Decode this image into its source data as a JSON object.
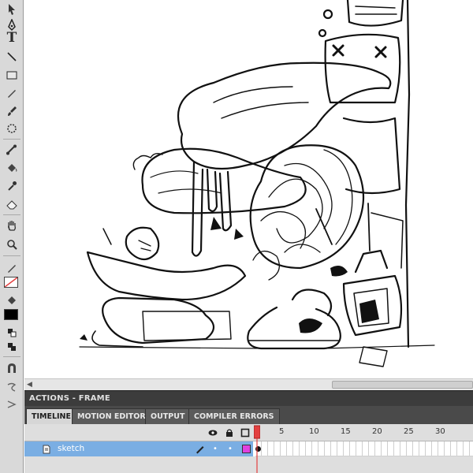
{
  "panels": {
    "actions_title": "ACTIONS - FRAME"
  },
  "timeline": {
    "tabs": [
      {
        "label": "TIMELINE",
        "active": true
      },
      {
        "label": "MOTION EDITOR",
        "active": false
      },
      {
        "label": "OUTPUT",
        "active": false
      },
      {
        "label": "COMPILER ERRORS",
        "active": false
      }
    ],
    "ruler": [
      "1",
      "5",
      "10",
      "15",
      "20",
      "25",
      "30"
    ],
    "layer": {
      "name": "sketch",
      "color": "#e040e0"
    }
  },
  "colors": {
    "stroke": "#000000",
    "fill": "#000000",
    "layer_highlight": "#7aaee3",
    "playhead": "#e33f3f"
  },
  "tools": [
    "subselect-icon",
    "pen-icon",
    "text-icon",
    "line-icon",
    "rectangle-icon",
    "pencil-icon",
    "brush-icon",
    "deco-icon",
    "bone-icon",
    "paint-bucket-icon",
    "eyedropper-icon",
    "eraser-icon",
    "hand-icon",
    "zoom-icon"
  ]
}
